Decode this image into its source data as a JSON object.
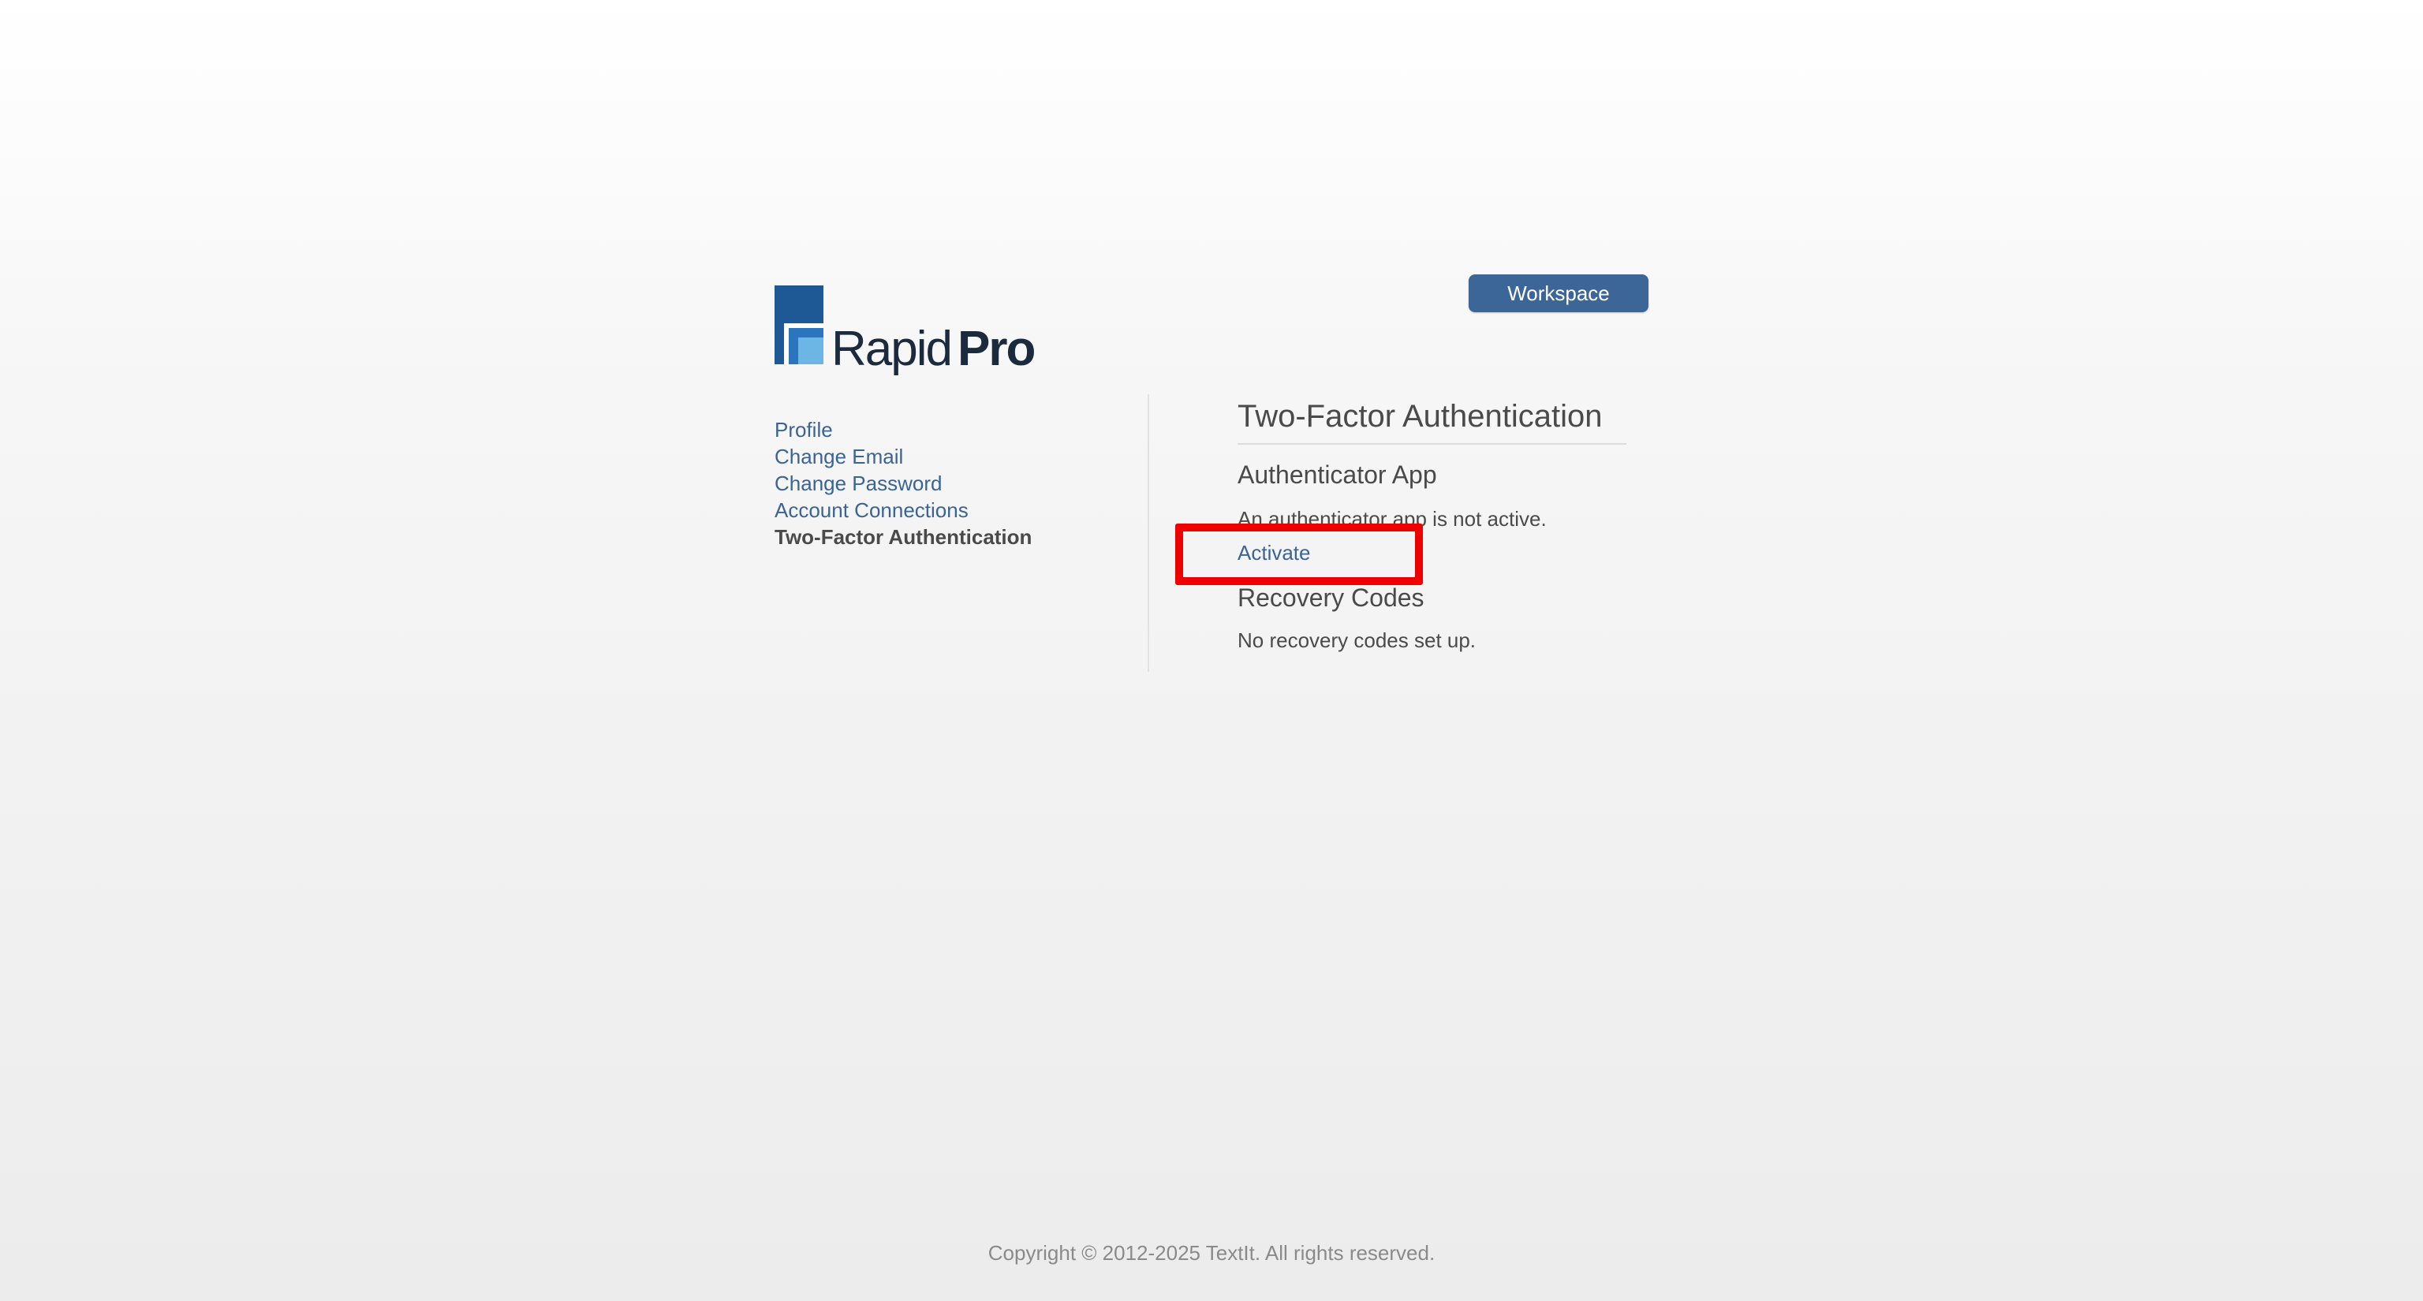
{
  "brand": {
    "logo_regular": "Rapid",
    "logo_bold": "Pro",
    "colors": {
      "dark_blue": "#1e5996",
      "mid_blue": "#2a75bd",
      "light_blue": "#6cb6e6"
    }
  },
  "header": {
    "workspace_label": "Workspace"
  },
  "sidebar": {
    "items": [
      {
        "label": "Profile"
      },
      {
        "label": "Change Email"
      },
      {
        "label": "Change Password"
      },
      {
        "label": "Account Connections"
      },
      {
        "label": "Two-Factor Authentication"
      }
    ],
    "active_item": "Two-Factor Authentication"
  },
  "main": {
    "title": "Two-Factor Authentication",
    "authenticator": {
      "heading": "Authenticator App",
      "status": "An authenticator app is not active.",
      "action": "Activate"
    },
    "recovery": {
      "heading": "Recovery Codes",
      "status": "No recovery codes set up."
    }
  },
  "annotation": {
    "highlight_color": "#ee0000"
  },
  "footer": {
    "copyright": "Copyright © 2012-2025 TextIt. All rights reserved."
  }
}
